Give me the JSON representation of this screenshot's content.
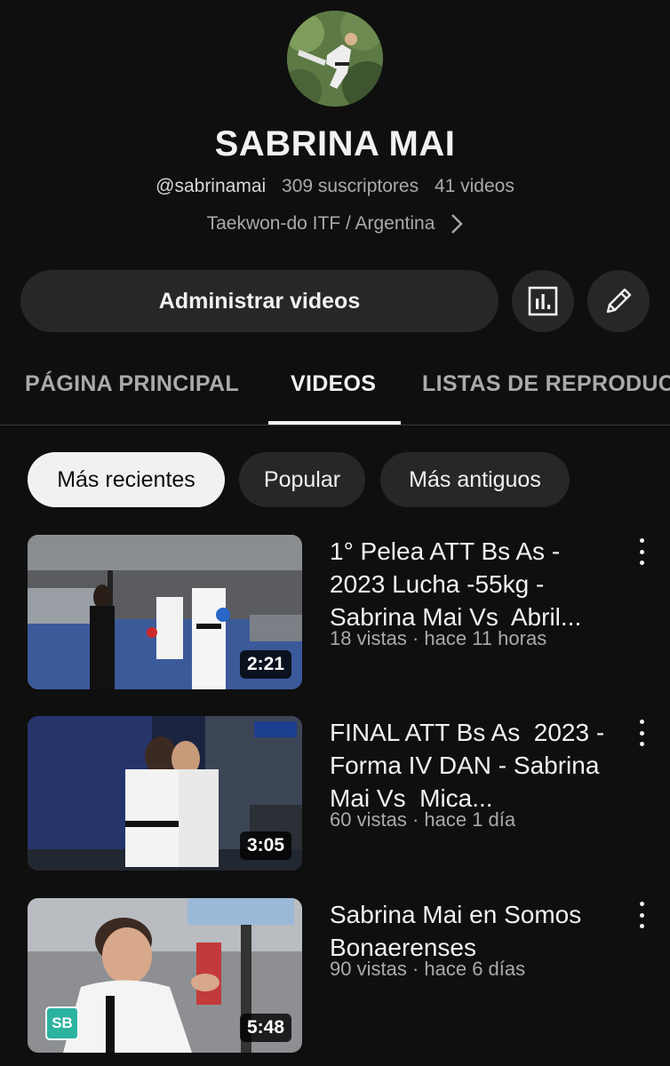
{
  "channel": {
    "name": "SABRINA MAI",
    "handle": "@sabrinamai",
    "subscribers": "309 suscriptores",
    "video_count": "41 videos",
    "description": "Taekwon-do ITF / Argentina"
  },
  "actions": {
    "manage_label": "Administrar videos",
    "stats_icon": "bar-chart-icon",
    "edit_icon": "pencil-icon"
  },
  "tabs": [
    {
      "label": "PÁGINA PRINCIPAL",
      "active": false
    },
    {
      "label": "VIDEOS",
      "active": true
    },
    {
      "label": "LISTAS DE REPRODUC",
      "active": false
    }
  ],
  "filters": [
    {
      "label": "Más recientes",
      "selected": true
    },
    {
      "label": "Popular",
      "selected": false
    },
    {
      "label": "Más antiguos",
      "selected": false
    }
  ],
  "videos": [
    {
      "title": "1° Pelea ATT Bs As - 2023 Lucha -55kg - Sabrina Mai Vs  Abril...",
      "views": "18 vistas",
      "age": "hace 11 horas",
      "duration": "2:21"
    },
    {
      "title": "FINAL ATT Bs As  2023 - Forma IV DAN - Sabrina Mai Vs  Mica...",
      "views": "60 vistas",
      "age": "hace 1 día",
      "duration": "3:05"
    },
    {
      "title": "Sabrina Mai en Somos Bonaerenses",
      "views": "90 vistas",
      "age": "hace 6 días",
      "duration": "5:48",
      "badge": "SB"
    }
  ],
  "colors": {
    "background": "#0f0f0f",
    "surface": "#272727",
    "text_primary": "#f1f1f1",
    "text_secondary": "#aaaaaa"
  }
}
